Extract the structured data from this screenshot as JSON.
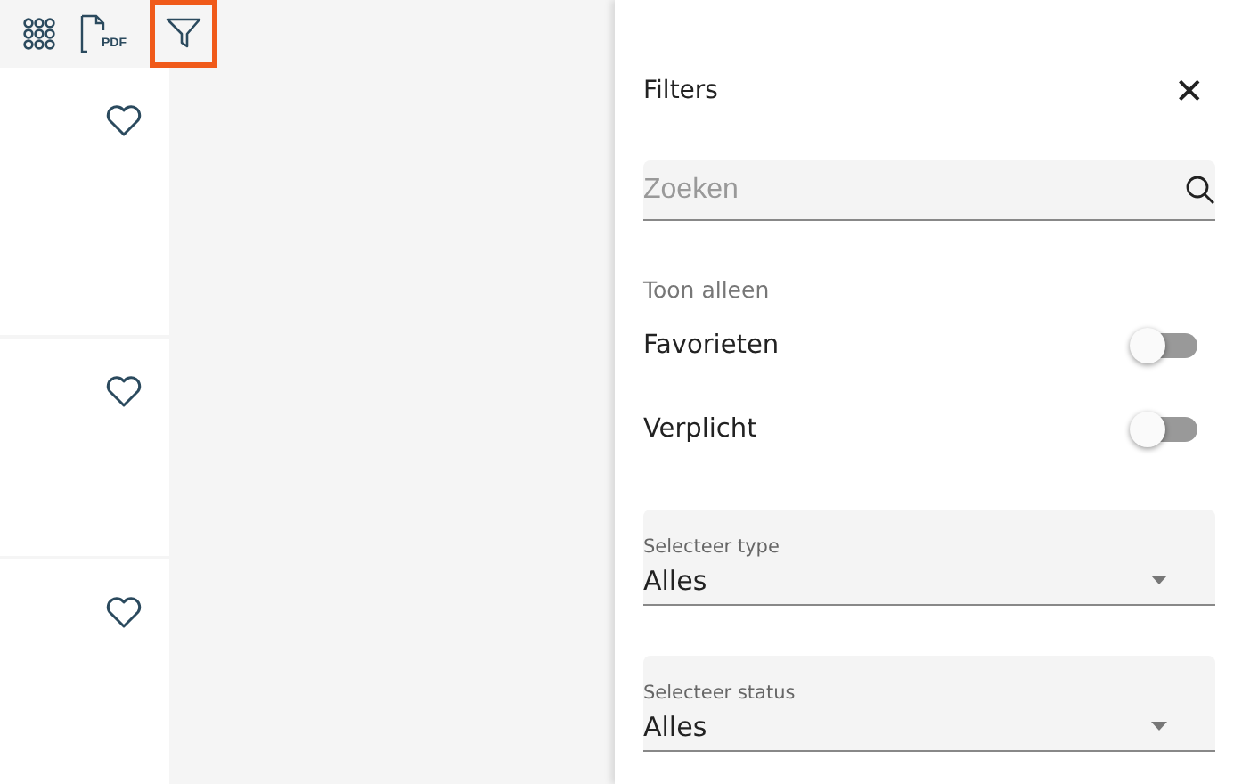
{
  "toolbar": {
    "buttons": [
      {
        "kind": "grid",
        "selected": false
      },
      {
        "kind": "pdf",
        "label": "PDF",
        "selected": false
      },
      {
        "kind": "filter",
        "selected": true
      }
    ]
  },
  "cards": [
    {
      "favorite": false
    },
    {
      "favorite": false
    },
    {
      "favorite": false
    }
  ],
  "filters": {
    "title": "Filters",
    "close": "✕",
    "search": {
      "placeholder": "Zoeken"
    },
    "section_label": "Toon alleen",
    "toggles": [
      {
        "label": "Favorieten",
        "on": false
      },
      {
        "label": "Verplicht",
        "on": false
      }
    ],
    "selects": [
      {
        "label": "Selecteer type",
        "value": "Alles"
      },
      {
        "label": "Selecteer status",
        "value": "Alles"
      }
    ]
  }
}
